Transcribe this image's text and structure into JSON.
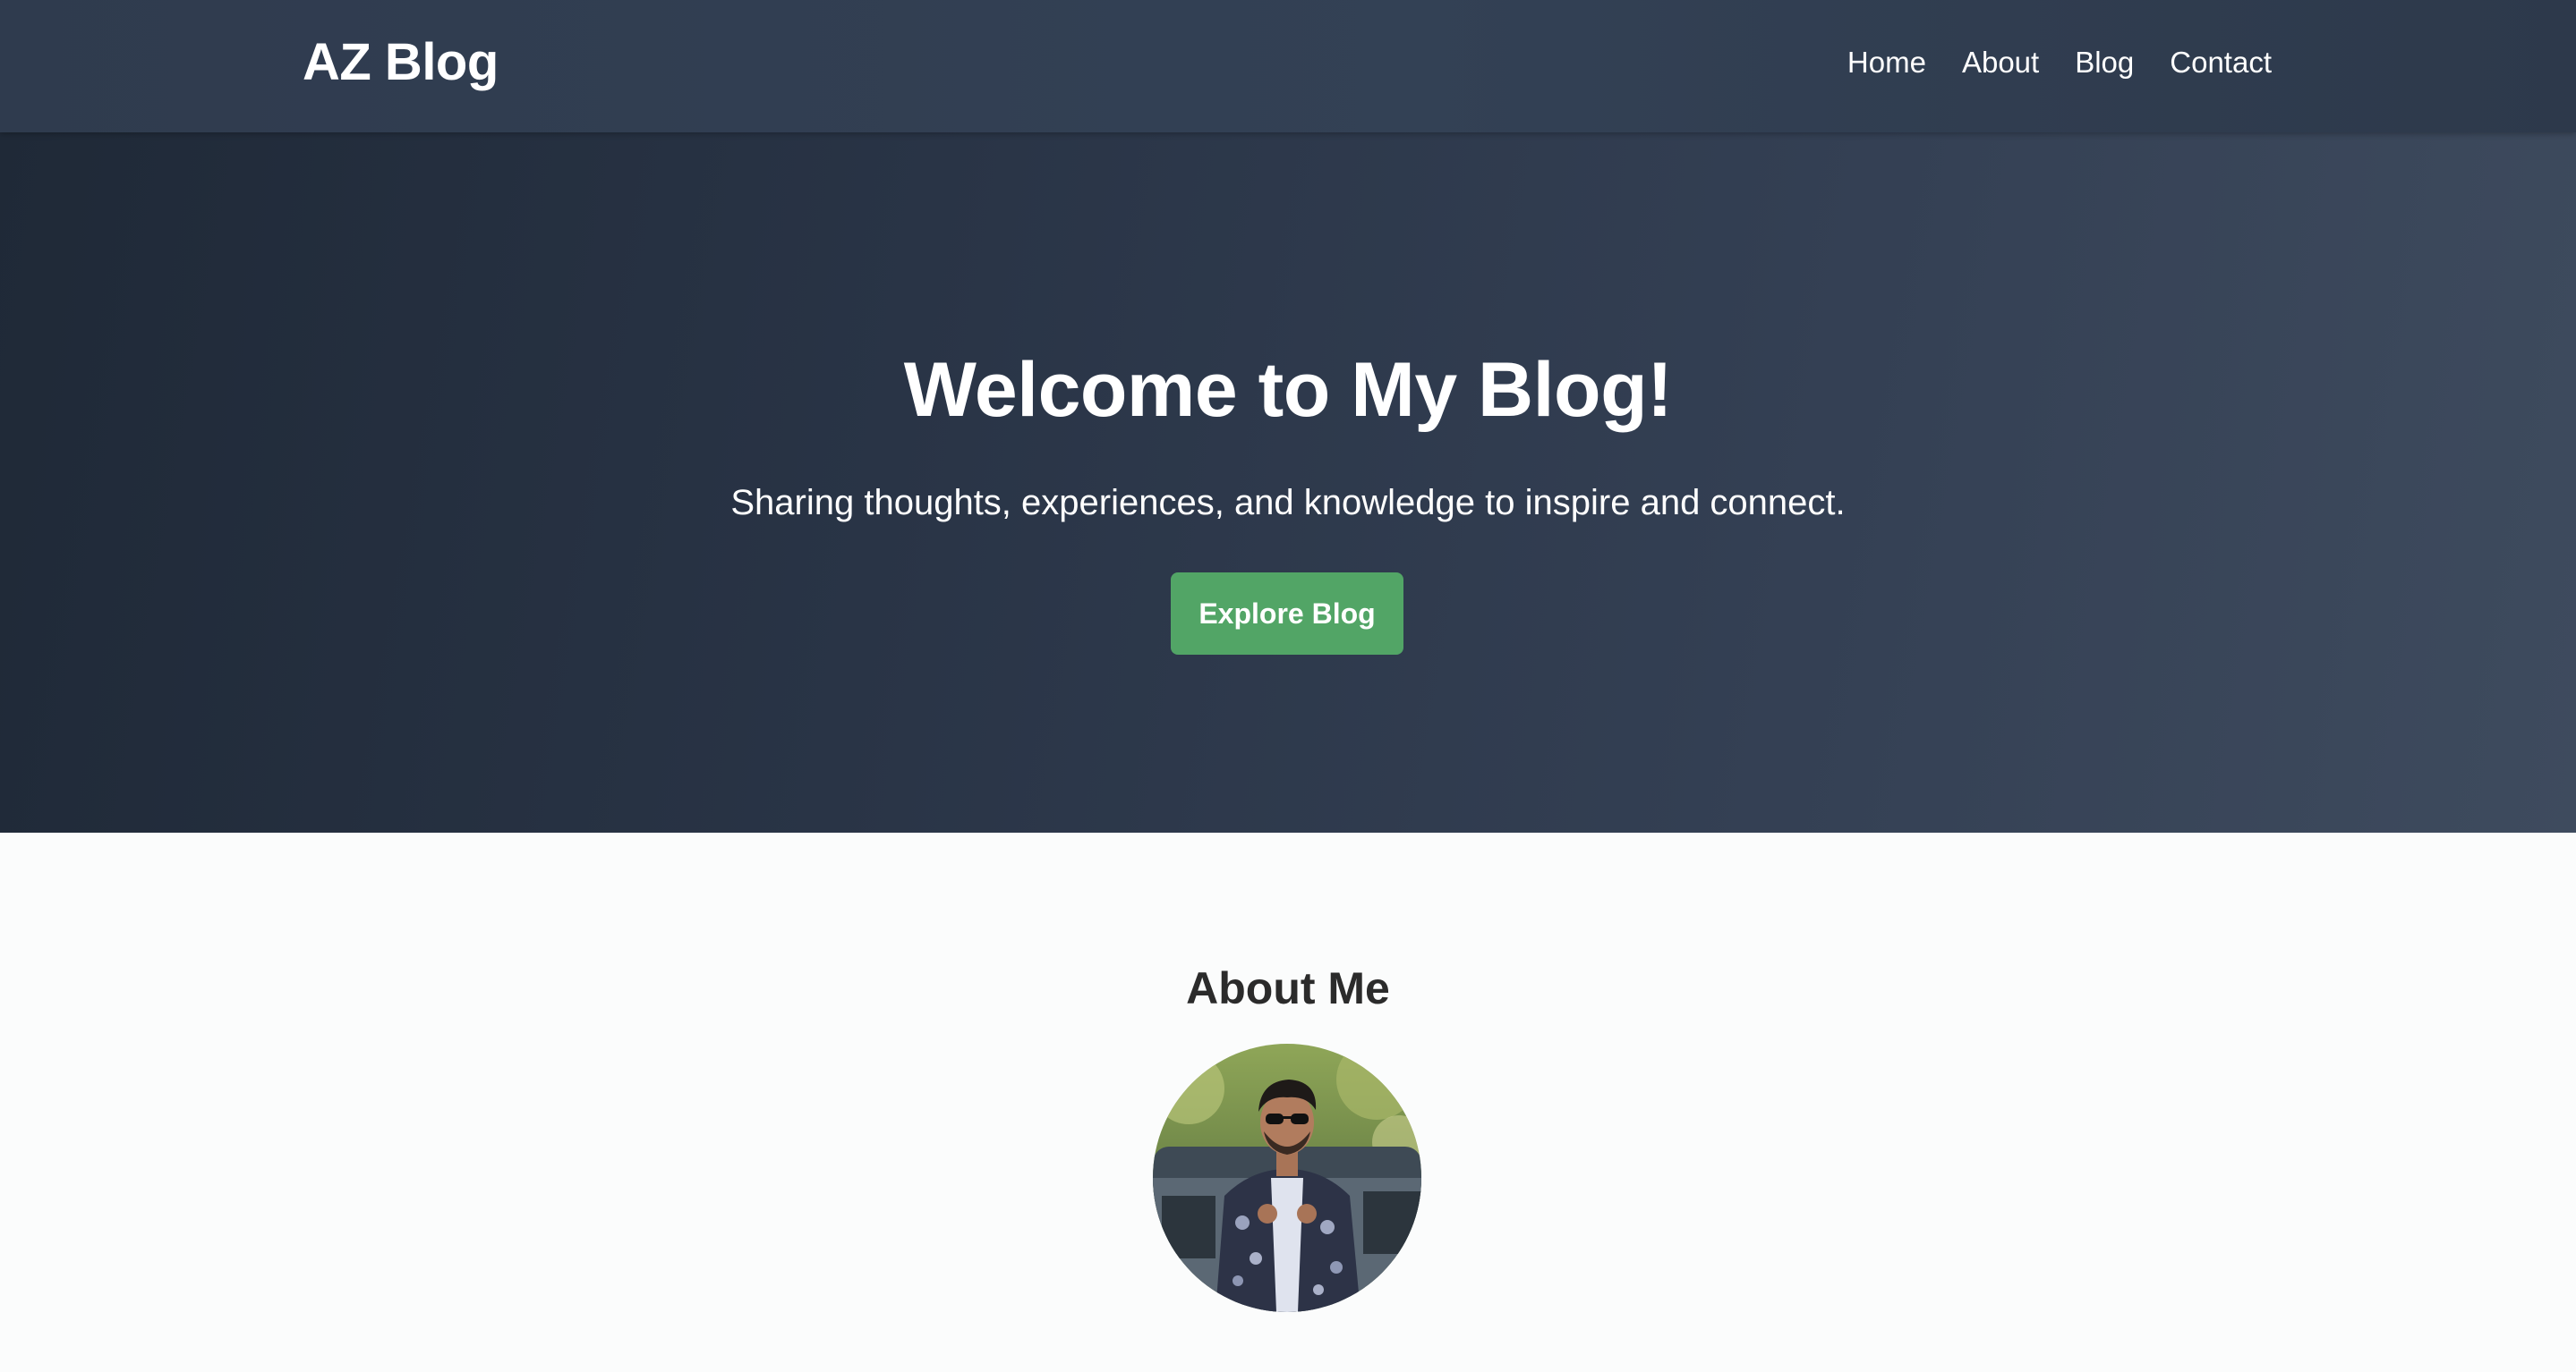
{
  "header": {
    "brand": "AZ Blog",
    "nav": [
      "Home",
      "About",
      "Blog",
      "Contact"
    ]
  },
  "hero": {
    "title": "Welcome to My Blog!",
    "subtitle": "Sharing thoughts, experiences, and knowledge to inspire and connect.",
    "cta_label": "Explore Blog"
  },
  "about": {
    "title": "About Me",
    "avatar_icon": "profile-photo"
  },
  "colors": {
    "header_bg": "#334155",
    "hero_bg_start": "#1f2937",
    "hero_bg_end": "#3e4b5e",
    "cta_green": "#52a566",
    "page_bg": "#fbfcfc",
    "heading_text": "#2b2b2b"
  }
}
